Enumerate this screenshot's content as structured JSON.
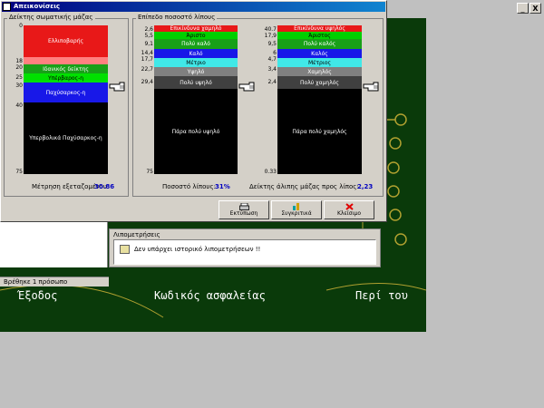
{
  "window": {
    "title": "Απεικονίσεις"
  },
  "background_app": {
    "menu": {
      "exit": "Έξοδος",
      "backup": "Κωδικός ασφαλείας",
      "about": "Περί του"
    },
    "status_text": "Βρέθηκε 1 πρόσωπο",
    "fat_measurements": {
      "group_title": "Λιπομετρήσεις",
      "empty_message": "Δεν υπάρχει ιστορικό λιπομετρήσεων !!"
    },
    "right_controls": {
      "minimize": "_",
      "close": "X"
    }
  },
  "bmi_panel": {
    "title": "Δείκτης σωματικής μάζας",
    "ticks": [
      "0",
      "18",
      "20",
      "25",
      "30",
      "40",
      "75"
    ],
    "segments": [
      "Ελλιποβαρής",
      "Ιδανικός δείκτης",
      "Υπέρβαρος-η",
      "Παχύσαρκος-η",
      "Υπερβολικά Παχύσαρκος-η"
    ],
    "measurement_label": "Μέτρηση εξεταζομένου:",
    "measurement_value": "30.86"
  },
  "fat_panel": {
    "title": "Επίπεδο ποσοστό λίπους",
    "ticks": [
      "2,6",
      "5,5",
      "9,1",
      "14,4",
      "17,7",
      "22,7",
      "29,4",
      "75"
    ],
    "segments": [
      "Επικίνδυνα χαμηλό",
      "Άριστο",
      "Πολύ καλό",
      "Καλό",
      "Μέτριο",
      "Υψηλό",
      "Πολύ υψηλό",
      "Πάρα πολύ υψηλό"
    ],
    "percent_label": "Ποσοστό λίπους:",
    "percent_value": "31%"
  },
  "lean_panel": {
    "ticks": [
      "40.7",
      "17,9",
      "9,5",
      "6",
      "4,7",
      "3,4",
      "2,4",
      "0.33"
    ],
    "segments": [
      "Επικίνδυνα υψηλός",
      "Άριστος",
      "Πολύ καλός",
      "Καλός",
      "Μέτριος",
      "Χαμηλός",
      "Πολύ χαμηλός",
      "Πάρα πολύ χαμηλός"
    ],
    "ratio_label": "Δείκτης άλιπης μάζας προς λίπος:",
    "ratio_value": "2,23"
  },
  "buttons": {
    "print": "Εκτύπωση",
    "compare": "Συγκριτικά",
    "close": "Κλείσιμο"
  },
  "colors": {
    "red": "#e81818",
    "salmon": "#ff8080",
    "green": "#18a018",
    "lime": "#00e000",
    "blue": "#1818e8",
    "cyan": "#40e8e8",
    "gray": "#404040",
    "dark_green": "#0a3a0a",
    "value_blue": "#0000c0"
  }
}
